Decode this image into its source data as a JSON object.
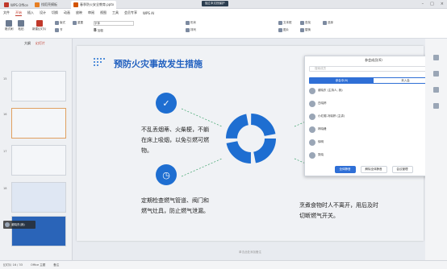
{
  "tabs": [
    {
      "label": "WPS Office"
    },
    {
      "label": "找稻壳模板"
    },
    {
      "label": "春季防火安全教育.pptx"
    }
  ],
  "top_right_label": "独立本文档保护",
  "menu": [
    "文件",
    "开始",
    "插入",
    "设计",
    "切换",
    "动画",
    "放映",
    "审阅",
    "视图",
    "工具",
    "会员专享",
    "WPS AI"
  ],
  "ribbon": {
    "items": [
      "格式刷",
      "粘贴",
      "新建幻灯片",
      "版式",
      "节",
      "重置",
      "字体",
      "加粗",
      "形状",
      "排列",
      "文本框",
      "图片",
      "查找",
      "替换",
      "选择"
    ]
  },
  "thumbs": {
    "tab_outline": "大纲",
    "tab_slides": "幻灯片",
    "numbers": [
      "15",
      "16",
      "17",
      "18",
      "19"
    ],
    "current_user": "谢晓东(我)"
  },
  "slide": {
    "title": "预防火灾事故发生措施",
    "text1": "不乱丢烟蒂、火柴梗，不躺在床上吸烟，以免引燃可燃物。",
    "text2": "定期检查燃气管道、阀门和燃气灶具，防止燃气泄漏。",
    "text3": "烹煮食物时人不离开，用后及时切断燃气开关。"
  },
  "notes": "单击此处添加备注",
  "panel": {
    "title": "参会成员(6)",
    "search_placeholder": "搜索成员",
    "tab_in": "参会中(6)",
    "tab_out": "未入会",
    "members": [
      {
        "name": "谢晓东",
        "sub": "(主持人, 我)",
        "status": ""
      },
      {
        "name": "白晓婷",
        "sub": "",
        "status": ""
      },
      {
        "name": "小红帽-冯晓婷",
        "sub": "(主讲)",
        "status": "静音"
      },
      {
        "name": "林晓峰",
        "sub": "",
        "status": "静音"
      },
      {
        "name": "徐明",
        "sub": "",
        "status": "静音"
      },
      {
        "name": "张晓",
        "sub": "",
        "status": "静音"
      }
    ],
    "btn_mute_all": "全体静音",
    "btn_unmute_all": "解除全体静音",
    "btn_settings": "会议管理"
  },
  "status": {
    "slide": "幻灯片 16 / 33",
    "theme": "Office 主题",
    "note": "备注"
  },
  "colors": {
    "accent": "#1e6ed1",
    "brand": "#c0392b"
  }
}
